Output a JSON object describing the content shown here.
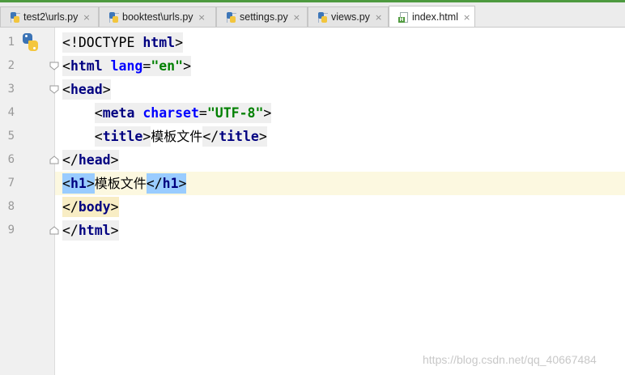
{
  "tabs": [
    {
      "label": "test2\\urls.py",
      "icon": "python-file-icon",
      "active": false
    },
    {
      "label": "booktest\\urls.py",
      "icon": "python-file-icon",
      "active": false
    },
    {
      "label": "settings.py",
      "icon": "python-file-icon",
      "active": false
    },
    {
      "label": "views.py",
      "icon": "python-file-icon",
      "active": false
    },
    {
      "label": "index.html",
      "icon": "html-file-icon",
      "active": true
    }
  ],
  "tab_close_glyph": "×",
  "html_icon_badge": "H",
  "editor": {
    "lines": [
      {
        "num": "1"
      },
      {
        "num": "2"
      },
      {
        "num": "3"
      },
      {
        "num": "4"
      },
      {
        "num": "5"
      },
      {
        "num": "6"
      },
      {
        "num": "7"
      },
      {
        "num": "8"
      },
      {
        "num": "9"
      }
    ],
    "code": {
      "l1": {
        "open": "<",
        "doctype": "!DOCTYPE",
        "sp": " ",
        "name": "html",
        "close": ">"
      },
      "l2": {
        "open": "<",
        "tag": "html",
        "sp": " ",
        "attr": "lang",
        "eq": "=",
        "val": "\"en\"",
        "close": ">"
      },
      "l3": {
        "open": "<",
        "tag": "head",
        "close": ">"
      },
      "l4": {
        "indent": "    ",
        "open": "<",
        "tag": "meta",
        "sp": " ",
        "attr": "charset",
        "eq": "=",
        "val": "\"UTF-8\"",
        "close": ">"
      },
      "l5": {
        "indent": "    ",
        "open": "<",
        "tag": "title",
        "close": ">",
        "text": "模板文件",
        "endopen": "</",
        "endtag": "title",
        "endclose": ">"
      },
      "l6": {
        "open": "</",
        "tag": "head",
        "close": ">"
      },
      "l7": {
        "open": "<",
        "tag": "h1",
        "close": ">",
        "text": "模板文件",
        "endopen": "</",
        "endtag": "h1",
        "endclose": ">"
      },
      "l8": {
        "open": "</",
        "tag": "body",
        "close": ">"
      },
      "l9": {
        "open": "</",
        "tag": "html",
        "close": ">"
      }
    },
    "current_line": "7"
  },
  "watermark": "https://blog.csdn.net/qq_40667484",
  "colors": {
    "tag": "#000080",
    "attribute": "#0000ff",
    "string": "#008000",
    "current_line": "#fcf8e0",
    "tag_match": "#99ccff",
    "accent": "#4d9a3f"
  }
}
